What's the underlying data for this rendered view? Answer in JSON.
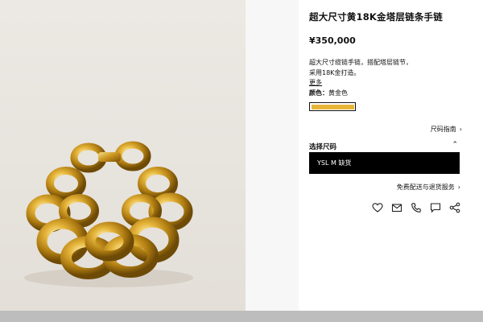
{
  "product": {
    "title": "超大尺寸黄18K金塔层链条手链",
    "price": "¥350,000",
    "description": [
      "超大尺寸缆链手链，搭配塔层链节，",
      "采用18K金打造。"
    ],
    "more_label": "更多",
    "color_label": "颜色：",
    "color_value": "黄金色",
    "swatch_color": "#e7b53a"
  },
  "size": {
    "guide_label": "尺码指南",
    "select_label": "选择尺码",
    "selected_text": "YSL M 缺货"
  },
  "shipping": {
    "label": "免费配送与退货服务"
  },
  "actions": {
    "icons": [
      "heart-icon",
      "mail-icon",
      "phone-icon",
      "chat-icon",
      "share-icon"
    ]
  },
  "theme": {
    "accent": "#000000",
    "gold": "#d9a527"
  }
}
